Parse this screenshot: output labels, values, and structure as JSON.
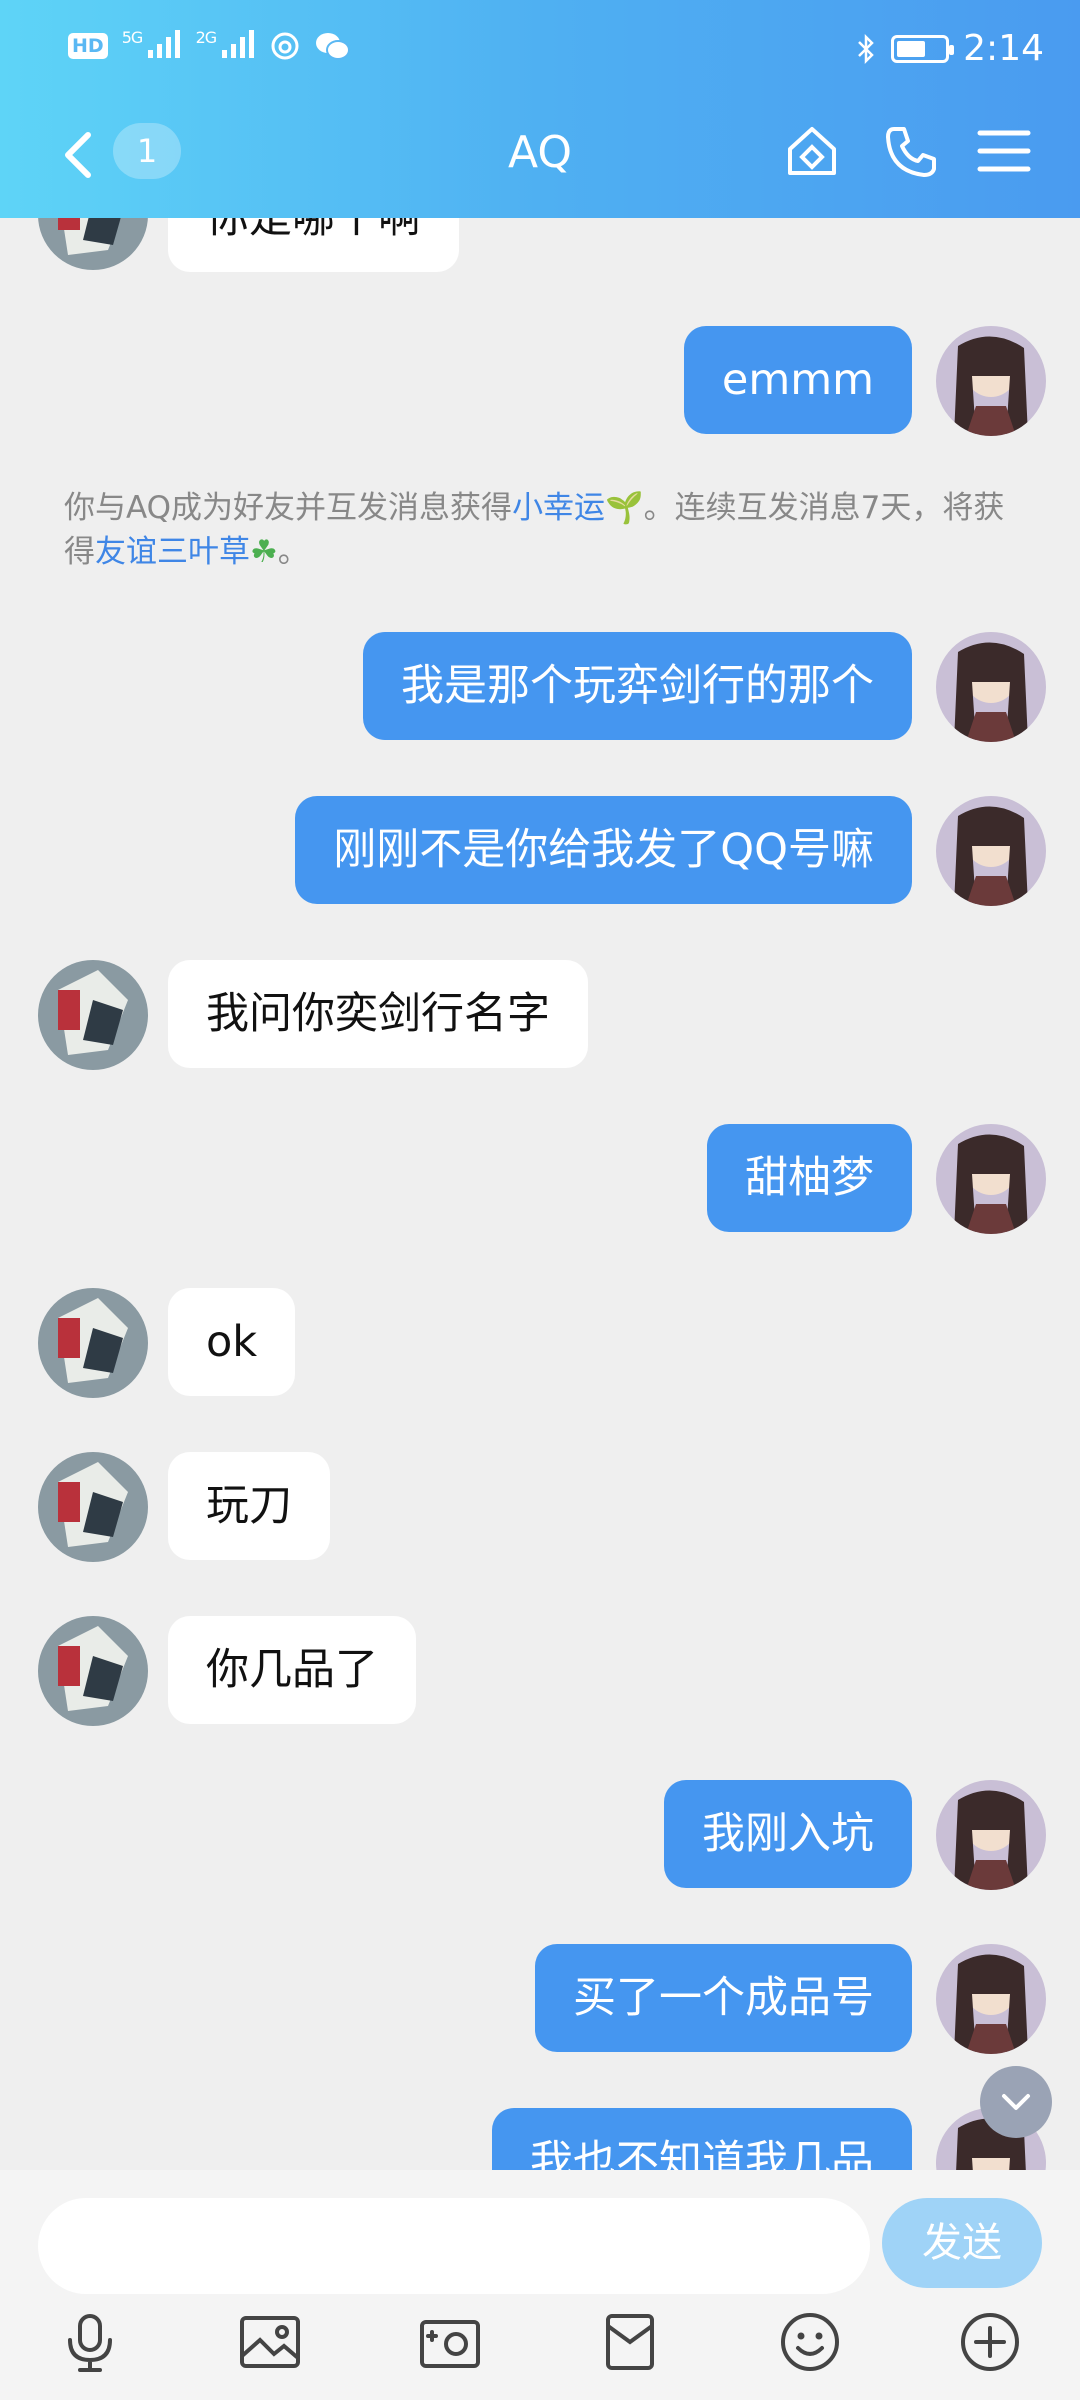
{
  "status_bar": {
    "hd": "HD",
    "sim1": "5G",
    "sim2": "2G",
    "time": "2:14"
  },
  "nav": {
    "unread_count": "1",
    "title": "AQ"
  },
  "messages": [
    {
      "side": "in",
      "text": "你是哪个啊"
    },
    {
      "side": "out",
      "text": "emmm"
    },
    {
      "side": "out",
      "text": "我是那个玩弈剑行的那个"
    },
    {
      "side": "out",
      "text": "刚刚不是你给我发了QQ号嘛"
    },
    {
      "side": "in",
      "text": "我问你奕剑行名字"
    },
    {
      "side": "out",
      "text": "甜柚梦"
    },
    {
      "side": "in",
      "text": "ok"
    },
    {
      "side": "in",
      "text": "玩刀"
    },
    {
      "side": "in",
      "text": "你几品了"
    },
    {
      "side": "out",
      "text": "我刚入坑"
    },
    {
      "side": "out",
      "text": "买了一个成品号"
    },
    {
      "side": "out",
      "text": "我也不知道我几品"
    }
  ],
  "notice": {
    "part1": "你与AQ成为好友并互发消息获得",
    "link1": "小幸运",
    "emoji1": "🌱",
    "part2": "。连续互发消息7天，将获得",
    "link2": "友谊三叶草",
    "emoji2": "☘",
    "part3": "。"
  },
  "input": {
    "send_label": "发送"
  },
  "colors": {
    "header_start": "#5ed4f7",
    "header_end": "#4a9bf0",
    "out_bubble": "#4596f0",
    "in_bubble": "#ffffff",
    "link": "#3f86e6"
  },
  "icons": {
    "toolbar": [
      "microphone-icon",
      "image-icon",
      "camera-icon",
      "red-packet-icon",
      "emoji-icon",
      "plus-icon"
    ]
  }
}
